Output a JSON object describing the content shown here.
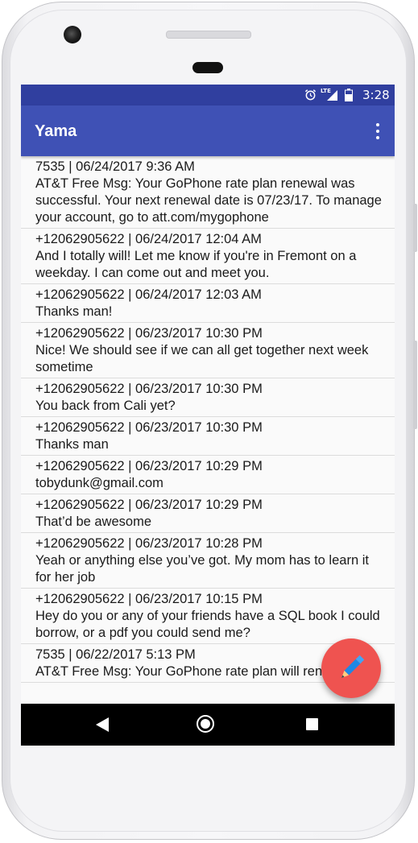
{
  "status_bar": {
    "time": "3:28",
    "icons": [
      "alarm-icon",
      "lte-signal-icon",
      "battery-icon"
    ],
    "background": "#303F9F"
  },
  "app_bar": {
    "title": "Yama",
    "menu_icon": "overflow-menu-icon",
    "background": "#3F51B5"
  },
  "messages": [
    {
      "header": "7535 | 06/24/2017 9:36 AM",
      "body": "AT&T Free Msg: Your GoPhone rate plan renewal was successful. Your next renewal date is 07/23/17. To manage your account, go to att.com/mygophone"
    },
    {
      "header": "+12062905622 | 06/24/2017 12:04 AM",
      "body": "And I totally will! Let me know if you're in Fremont on a weekday. I can come out and meet you."
    },
    {
      "header": "+12062905622 | 06/24/2017 12:03 AM",
      "body": "Thanks man!"
    },
    {
      "header": "+12062905622 | 06/23/2017 10:30 PM",
      "body": "Nice! We should see if we can all get together next week sometime"
    },
    {
      "header": "+12062905622 | 06/23/2017 10:30 PM",
      "body": "You back from Cali yet?"
    },
    {
      "header": "+12062905622 | 06/23/2017 10:30 PM",
      "body": "Thanks man"
    },
    {
      "header": "+12062905622 | 06/23/2017 10:29 PM",
      "body": "tobydunk@gmail.com"
    },
    {
      "header": "+12062905622 | 06/23/2017 10:29 PM",
      "body": "That’d be awesome"
    },
    {
      "header": "+12062905622 | 06/23/2017 10:28 PM",
      "body": "Yeah or anything else you’ve got. My mom has to learn it for her job"
    },
    {
      "header": "+12062905622 | 06/23/2017 10:15 PM",
      "body": "Hey do you or any of your friends have a SQL book I could borrow, or a pdf you could send me?"
    },
    {
      "header": "7535 | 06/22/2017 5:13 PM",
      "body": "AT&T Free Msg: Your GoPhone rate plan will renew"
    }
  ],
  "fab": {
    "icon": "pencil-icon",
    "color": "#EF5350"
  },
  "nav_bar": {
    "icons": [
      "back-icon",
      "home-icon",
      "recent-apps-icon"
    ]
  }
}
